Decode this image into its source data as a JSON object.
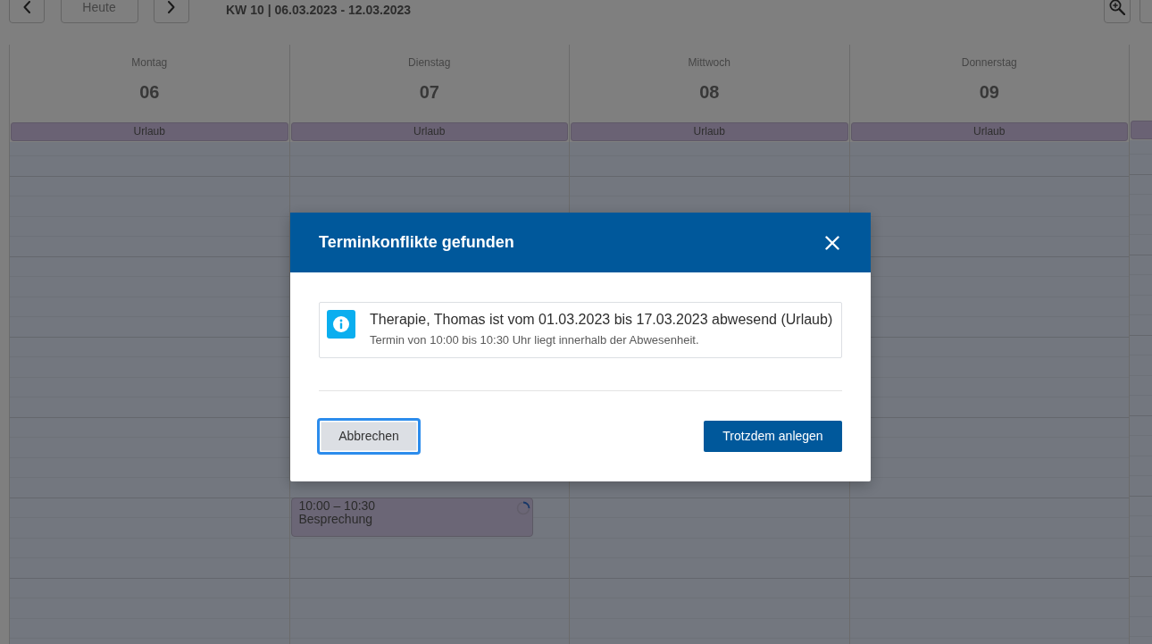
{
  "toolbar": {
    "nav_buttons": [
      {
        "kind": "prev"
      },
      {
        "kind": "today",
        "label": "Heute"
      },
      {
        "kind": "next"
      }
    ],
    "title": "KW 10 | 06.03.2023 - 12.03.2023",
    "tool_buttons": [
      {
        "kind": "zoom_in"
      },
      {
        "kind": "other"
      }
    ]
  },
  "calendar": {
    "days": [
      {
        "weekday": "Montag",
        "date": "06",
        "absence": "Urlaub"
      },
      {
        "weekday": "Dienstag",
        "date": "07",
        "absence": "Urlaub",
        "events": [
          {
            "time": "10:00 – 10:30",
            "title": "Besprechung",
            "loading": true
          }
        ]
      },
      {
        "weekday": "Mittwoch",
        "date": "08",
        "absence": "Urlaub"
      },
      {
        "weekday": "Donnerstag",
        "date": "09",
        "absence": "Urlaub"
      },
      {
        "absence_bar": true
      }
    ]
  },
  "dialog": {
    "title": "Terminkonflikte gefunden",
    "conflicts": [
      {
        "kind": "info",
        "title": "Therapie, Thomas ist vom 01.03.2023 bis 17.03.2023 abwesend (Urlaub)",
        "detail": "Termin von 10:00 bis 10:30 Uhr liegt innerhalb der Abwesenheit."
      }
    ],
    "buttons": [
      {
        "label": "Abbrechen",
        "kind": "secondary",
        "focused": true
      },
      {
        "label": "Trotzdem anlegen",
        "kind": "primary",
        "focused": false
      }
    ]
  }
}
